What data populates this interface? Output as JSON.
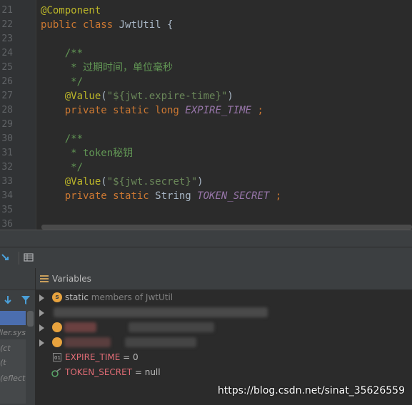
{
  "editor": {
    "lines": [
      {
        "n": "21",
        "parts": [
          {
            "t": "@Component",
            "c": "ann"
          }
        ]
      },
      {
        "n": "22",
        "parts": [
          {
            "t": "public class ",
            "c": "kw"
          },
          {
            "t": "JwtUtil {",
            "c": ""
          }
        ]
      },
      {
        "n": "23",
        "parts": []
      },
      {
        "n": "24",
        "parts": [
          {
            "t": "    /**",
            "c": "cmt"
          }
        ]
      },
      {
        "n": "25",
        "parts": [
          {
            "t": "     * 过期时间，单位毫秒",
            "c": "cmt"
          }
        ]
      },
      {
        "n": "26",
        "parts": [
          {
            "t": "     */",
            "c": "cmt"
          }
        ]
      },
      {
        "n": "27",
        "parts": [
          {
            "t": "    @Value",
            "c": "ann"
          },
          {
            "t": "(",
            "c": ""
          },
          {
            "t": "\"${jwt.expire-time}\"",
            "c": "str"
          },
          {
            "t": ")",
            "c": ""
          }
        ]
      },
      {
        "n": "28",
        "parts": [
          {
            "t": "    private static long ",
            "c": "kw"
          },
          {
            "t": "EXPIRE_TIME",
            "c": "fld"
          },
          {
            "t": " ;",
            "c": "sep"
          }
        ]
      },
      {
        "n": "29",
        "parts": []
      },
      {
        "n": "30",
        "parts": [
          {
            "t": "    /**",
            "c": "cmt"
          }
        ]
      },
      {
        "n": "31",
        "parts": [
          {
            "t": "     * token秘钥",
            "c": "cmt"
          }
        ]
      },
      {
        "n": "32",
        "parts": [
          {
            "t": "     */",
            "c": "cmt"
          }
        ]
      },
      {
        "n": "33",
        "parts": [
          {
            "t": "    @Value",
            "c": "ann"
          },
          {
            "t": "(",
            "c": ""
          },
          {
            "t": "\"${jwt.secret}\"",
            "c": "str"
          },
          {
            "t": ")",
            "c": ""
          }
        ]
      },
      {
        "n": "34",
        "parts": [
          {
            "t": "    private static ",
            "c": "kw"
          },
          {
            "t": "String ",
            "c": ""
          },
          {
            "t": "TOKEN_SECRET",
            "c": "fld"
          },
          {
            "t": " ;",
            "c": "sep"
          }
        ]
      },
      {
        "n": "35",
        "parts": []
      },
      {
        "n": "36",
        "parts": []
      }
    ]
  },
  "frames": {
    "items": [
      "ller.sys",
      "ct)",
      "t)",
      "eflect)"
    ]
  },
  "variables": {
    "title": "Variables",
    "static_row": {
      "badge": "s",
      "keyword": "static",
      "rest": " members of JwtUtil"
    },
    "expire": {
      "name": "EXPIRE_TIME",
      "eq": " = ",
      "value": "0"
    },
    "token": {
      "name": "TOKEN_SECRET",
      "eq": " = ",
      "value": "null"
    }
  },
  "watermark": "https://blog.csdn.net/sinat_35626559",
  "colors": {
    "accent": "#4b6eaf",
    "badge": "#e8a33e",
    "field_name": "#e06c75"
  }
}
